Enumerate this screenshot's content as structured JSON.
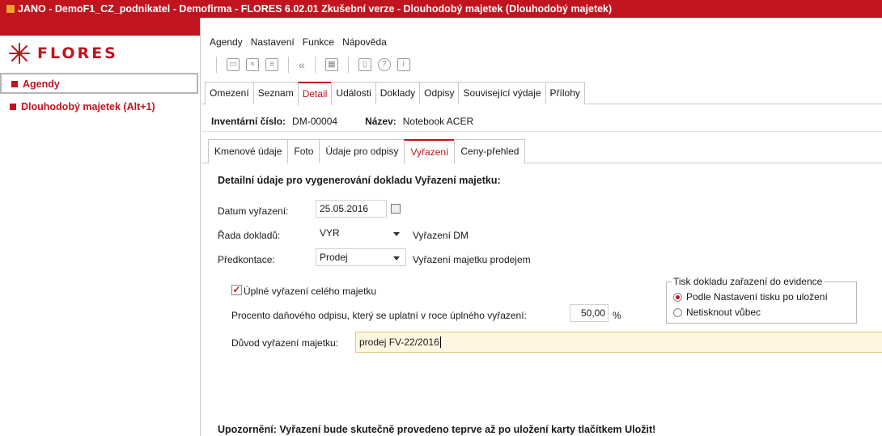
{
  "window": {
    "title": "JANO - DemoF1_CZ_podnikatel - Demofirma - FLORES 6.02.01 Zkušební verze - Dlouhodobý majetek  (Dlouhodobý majetek)"
  },
  "logo": {
    "text": "FLORES"
  },
  "sidebar": {
    "items": [
      {
        "label": "Agendy"
      },
      {
        "label": "Dlouhodobý majetek (Alt+1)"
      }
    ]
  },
  "menu": {
    "items": [
      "Agendy",
      "Nastavení",
      "Funkce",
      "Nápověda"
    ]
  },
  "tabs": [
    "Omezení",
    "Seznam",
    "Detail",
    "Události",
    "Doklady",
    "Odpisy",
    "Související výdaje",
    "Přílohy"
  ],
  "active_tab": "Detail",
  "record": {
    "inv_label": "Inventární číslo:",
    "inv_value": "DM-00004",
    "name_label": "Název:",
    "name_value": "Notebook ACER"
  },
  "subtabs": [
    "Kmenové údaje",
    "Foto",
    "Údaje pro odpisy",
    "Vyřazení",
    "Ceny-přehled"
  ],
  "active_subtab": "Vyřazení",
  "form": {
    "section_title": "Detailní údaje pro vygenerování dokladu Vyřazení majetku:",
    "date_label": "Datum vyřazení:",
    "date_value": "25.05.2016",
    "series_label": "Řada dokladů:",
    "series_value": "VYR",
    "series_desc": "Vyřazení DM",
    "precontact_label": "Předkontace:",
    "precontact_value": "Prodej",
    "precontact_desc": "Vyřazení majetku prodejem",
    "full_disposal_label": "Úplné vyřazení celého majetku",
    "full_disposal_checked": true,
    "percent_label": "Procento daňového odpisu, který se uplatní v roce úplného vyřazení:",
    "percent_value": "50,00",
    "percent_unit": "%",
    "reason_label": "Důvod vyřazení majetku:",
    "reason_value": "prodej FV-22/2016",
    "print_group_title": "Tisk dokladu zařazení do evidence",
    "print_options": [
      "Podle Nastavení tisku po uložení",
      "Netisknout vůbec"
    ],
    "print_selected": 0,
    "warning": "Upozornění: Vyřazení bude skutečně provedeno teprve až po uložení karty tlačítkem Uložit!"
  }
}
